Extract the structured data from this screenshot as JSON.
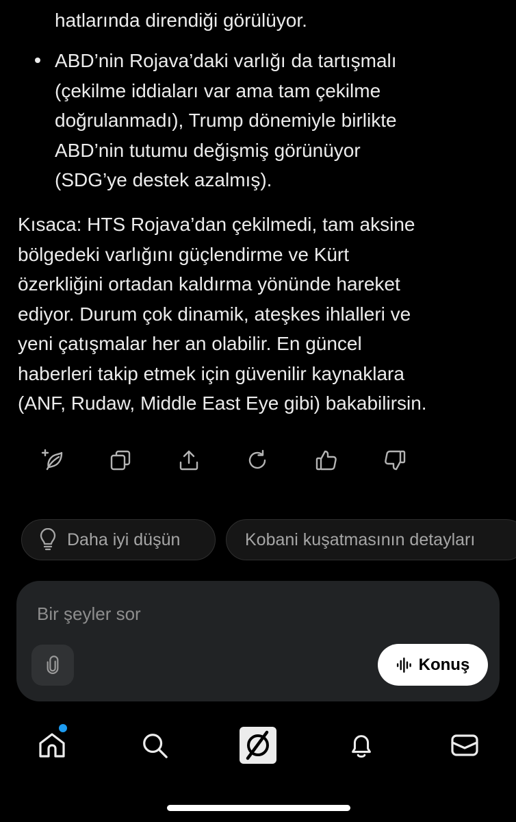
{
  "message": {
    "first_line": "hatlarında direndiği görülüyor.",
    "bullet_lines": [
      "ABD’nin Rojava’daki varlığı da tartışmalı",
      "(çekilme iddiaları var ama tam çekilme",
      "doğrulanmadı), Trump dönemiyle birlikte",
      "ABD’nin tutumu değişmiş görünüyor",
      "(SDG’ye destek azalmış)."
    ],
    "summary_lines": [
      "Kısaca: HTS Rojava’dan çekilmedi, tam aksine",
      "bölgedeki varlığını güçlendirme ve Kürt",
      "özerkliğini ortadan kaldırma yönünde hareket",
      "ediyor. Durum çok dinamik, ateşkes ihlalleri ve",
      "yeni çatışmalar her an olabilir. En güncel",
      "haberleri takip etmek için güvenilir kaynaklara",
      "(ANF, Rudaw, Middle East Eye gibi) bakabilirsin."
    ]
  },
  "actions": [
    {
      "name": "regenerate-sparkle-icon"
    },
    {
      "name": "copy-icon"
    },
    {
      "name": "share-icon"
    },
    {
      "name": "refresh-icon"
    },
    {
      "name": "thumbs-up-icon"
    },
    {
      "name": "thumbs-down-icon"
    }
  ],
  "suggestions": {
    "think_better": "Daha iyi düşün",
    "kobani": "Kobani kuşatmasının detayları"
  },
  "composer": {
    "placeholder": "Bir şeyler sor",
    "talk_label": "Konuş"
  },
  "tabbar": {
    "items": [
      "home-icon",
      "search-icon",
      "grok-icon",
      "bell-icon",
      "mail-icon"
    ],
    "home_badge_color": "#1d9bf0"
  },
  "colors": {
    "background": "#000000",
    "text": "#ececec",
    "composer": "#212325",
    "accent": "#1d9bf0"
  }
}
